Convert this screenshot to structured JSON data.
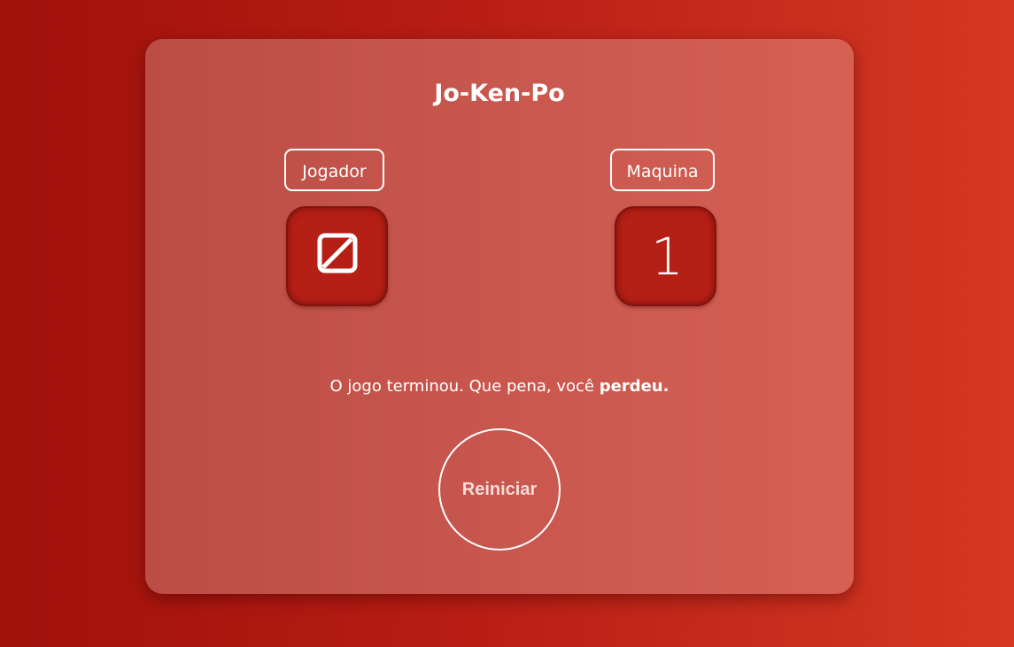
{
  "game": {
    "title": "Jo-Ken-Po",
    "player_label": "Jogador",
    "machine_label": "Maquina",
    "player_choice_icon": "empty-square-icon",
    "machine_choice": "1",
    "message_prefix": "O jogo terminou. Que pena, você ",
    "message_result": "perdeu.",
    "restart_label": "Reiniciar"
  },
  "colors": {
    "background_start": "#a0110b",
    "background_end": "#d43823",
    "card": "#c8574e",
    "tile": "#b51f15",
    "text": "#ffffff"
  }
}
